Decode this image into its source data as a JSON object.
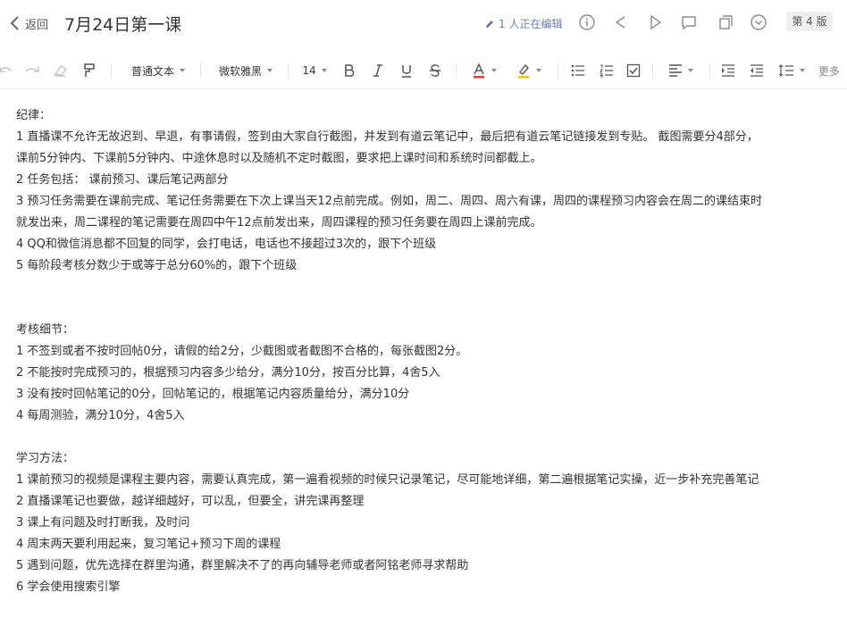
{
  "header": {
    "back_label": "返回",
    "title": "7月24日第一课",
    "editing_status": "1 人正在编辑",
    "version_label": "第 4 版"
  },
  "toolbar": {
    "style_select": "普通文本",
    "font_select": "微软雅黑",
    "size_select": "14",
    "more_label": "更多",
    "font_color": "#d9403a",
    "highlight_color": "#f2c200"
  },
  "document": {
    "section1": {
      "heading": "纪律：",
      "lines": [
        "1 直播课不允许无故迟到、早退，有事请假，签到由大家自行截图，并发到有道云笔记中，最后把有道云笔记链接发到专贴。 截图需要分4部分，",
        "课前5分钟内、下课前5分钟内、中途休息时以及随机不定时截图，要求把上课时间和系统时间都截上。",
        "2 任务包括： 课前预习、课后笔记两部分",
        "3 预习任务需要在课前完成、笔记任务需要在下次上课当天12点前完成。例如，周二、周四、周六有课，周四的课程预习内容会在周二的课结束时",
        "就发出来，周二课程的笔记需要在周四中午12点前发出来，周四课程的预习任务要在周四上课前完成。",
        "4 QQ和微信消息都不回复的同学，会打电话，电话也不接超过3次的，跟下个班级",
        "5 每阶段考核分数少于或等于总分60%的，跟下个班级"
      ]
    },
    "section2": {
      "heading": "考核细节：",
      "lines": [
        "1 不签到或者不按时回帖0分，请假的给2分，少截图或者截图不合格的，每张截图2分。",
        "2 不能按时完成预习的，根据预习内容多少给分，满分10分，按百分比算，4舍5入",
        "3 没有按时回帖笔记的0分，回帖笔记的，根据笔记内容质量给分，满分10分",
        "4 每周测验，满分10分，4舍5入"
      ]
    },
    "section3": {
      "heading": "学习方法：",
      "lines": [
        "1 课前预习的视频是课程主要内容，需要认真完成，第一遍看视频的时候只记录笔记，尽可能地详细，第二遍根据笔记实操，近一步补充完善笔记",
        "2 直播课笔记也要做，越详细越好，可以乱，但要全，讲完课再整理",
        "3 课上有问题及时打断我，及时问",
        "4 周末两天要利用起来，复习笔记+预习下周的课程",
        "5 遇到问题，优先选择在群里沟通，群里解决不了的再向辅导老师或者阿铭老师寻求帮助",
        "6 学会使用搜索引擎"
      ]
    }
  }
}
